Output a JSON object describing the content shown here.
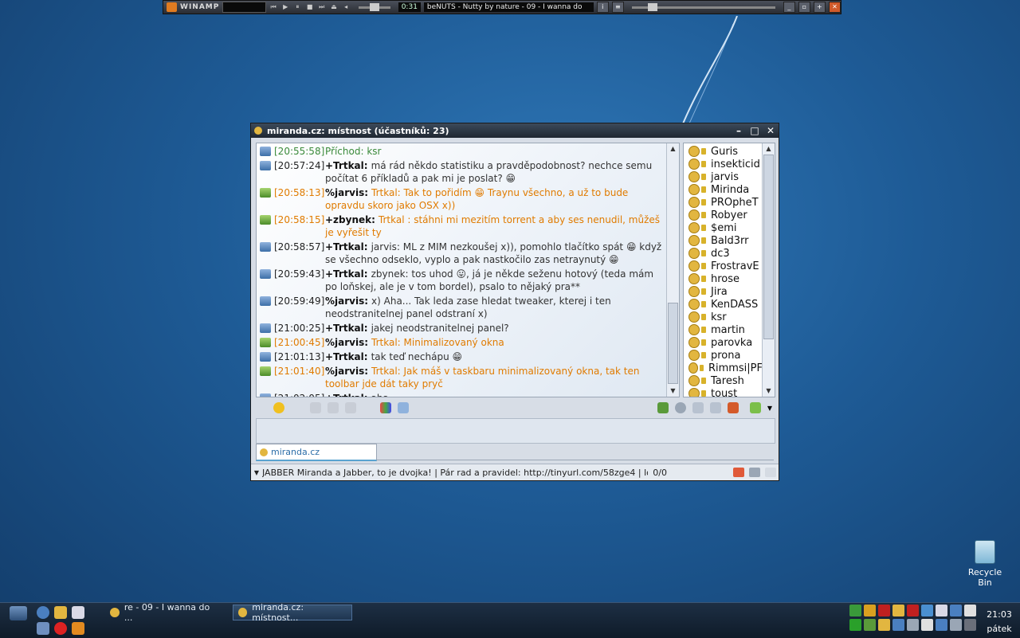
{
  "winamp": {
    "label": "WINAMP",
    "time": "0:31",
    "track": "beNUTS - Nutty by nature - 09 - I wanna do"
  },
  "window": {
    "title": "miranda.cz: místnost (účastníků: 23)",
    "messages": [
      {
        "time": "[20:55:58]",
        "nick": "",
        "text": "Příchod: ksr",
        "style": "green",
        "icon": "blue"
      },
      {
        "time": "[20:57:24]",
        "nick": "+Trtkal:",
        "text": "má rád někdo statistiku a pravděpodobnost? nechce semu počítat 6 příkladů a pak mi je poslat? 😁",
        "style": "normal",
        "icon": "blue"
      },
      {
        "time": "[20:58:13]",
        "nick": "%jarvis:",
        "text": "Trtkal: Tak to pořidím 😁 Traynu všechno, a už to bude opravdu skoro jako OSX x))",
        "style": "orange",
        "icon": "green"
      },
      {
        "time": "[20:58:15]",
        "nick": "+zbynek:",
        "text": "Trtkal : stáhni mi mezitím torrent a aby ses nenudil, můžeš je vyřešit ty",
        "style": "orange",
        "icon": "green"
      },
      {
        "time": "[20:58:57]",
        "nick": "+Trtkal:",
        "text": "jarvis: ML z MIM nezkoušej x)), pomohlo tlačítko spát 😁 když se všechno odseklo, vyplo a pak nastkočilo zas netraynutý 😁",
        "style": "normal",
        "icon": "blue"
      },
      {
        "time": "[20:59:43]",
        "nick": "+Trtkal:",
        "text": "zbynek: tos uhod 😛, já je někde seženu hotový (teda mám po loňskej, ale je v tom bordel), psalo to nějaký pra**",
        "style": "normal",
        "icon": "blue"
      },
      {
        "time": "[20:59:49]",
        "nick": "%jarvis:",
        "text": "x) Aha... Tak leda zase hledat tweaker, kterej i ten neodstranitelnej panel odstraní x)",
        "style": "normal",
        "icon": "blue"
      },
      {
        "time": "[21:00:25]",
        "nick": "+Trtkal:",
        "text": "jakej neodstranitelnej panel?",
        "style": "normal",
        "icon": "blue"
      },
      {
        "time": "[21:00:45]",
        "nick": "%jarvis:",
        "text": "Trtkal: Minimalizovaný okna",
        "style": "orange",
        "icon": "green"
      },
      {
        "time": "[21:01:13]",
        "nick": "+Trtkal:",
        "text": "tak teď nechápu 😁",
        "style": "normal",
        "icon": "blue"
      },
      {
        "time": "[21:01:40]",
        "nick": "%jarvis:",
        "text": "Trtkal: Jak máš v taskbaru minimalizovaný okna, tak ten toolbar jde dát taky pryč",
        "style": "orange",
        "icon": "green"
      },
      {
        "time": "[21:02:05]",
        "nick": "+Trtkal:",
        "text": "aha",
        "style": "normal",
        "icon": "blue"
      }
    ],
    "users": [
      "Guris",
      "insekticid",
      "jarvis",
      "Mirinda",
      "PROpheT",
      "Robyer",
      "$emi",
      "Bald3rr",
      "dc3",
      "FrostravE",
      "hrose",
      "Jira",
      "KenDASS",
      "ksr",
      "martin",
      "parovka",
      "prona",
      "Rimmsi|PF",
      "Taresh",
      "toust"
    ],
    "tab_label": "miranda.cz",
    "status_text": "JABBER Miranda a Jabber, to je dvojka! | Pár rad a pravidel: http://tinyurl.com/58zge4 | log místnc",
    "status_count": "0/0"
  },
  "desktop": {
    "recycle_label": "Recycle Bin"
  },
  "taskbar": {
    "tasks": [
      "re - 09 - I wanna do ...",
      "miranda.cz: místnost..."
    ],
    "clock_time": "21:03",
    "clock_day": "pátek"
  },
  "colors": {
    "orange": "#e07b00",
    "green": "#3a8a3a"
  }
}
